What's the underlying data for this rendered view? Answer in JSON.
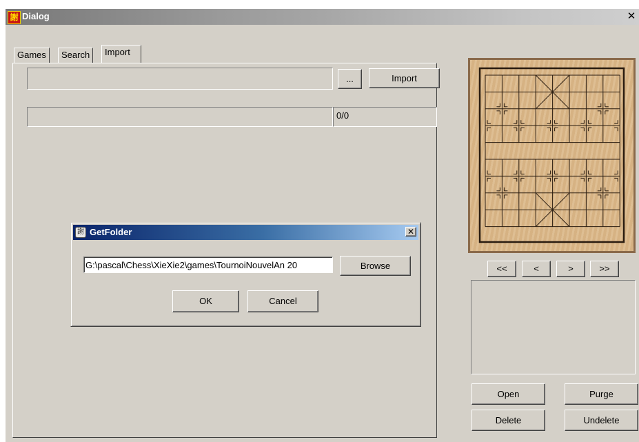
{
  "window": {
    "title": "Dialog",
    "app_icon_glyph": "謝",
    "close_glyph": "✕"
  },
  "tabs": [
    {
      "label": "Games"
    },
    {
      "label": "Search"
    },
    {
      "label": "Import",
      "active": true
    }
  ],
  "import": {
    "file_value": "",
    "browse_label": "...",
    "import_label": "Import",
    "progress_value": "",
    "progress_count": "0/0"
  },
  "navigation": {
    "first": "<<",
    "prev": "<",
    "next": ">",
    "last": ">>"
  },
  "actions": {
    "open": "Open",
    "purge": "Purge",
    "delete": "Delete",
    "undelete": "Undelete"
  },
  "get_folder_dialog": {
    "title": "GetFolder",
    "close_glyph": "✕",
    "path_value": "G:\\pascal\\Chess\\XieXie2\\games\\TournoiNouvelAn 20",
    "browse_label": "Browse",
    "ok_label": "OK",
    "cancel_label": "Cancel"
  },
  "colors": {
    "dialog_face": "#d4d0c8",
    "active_title": "#0a246a",
    "board_wood": "#dbb98a"
  }
}
